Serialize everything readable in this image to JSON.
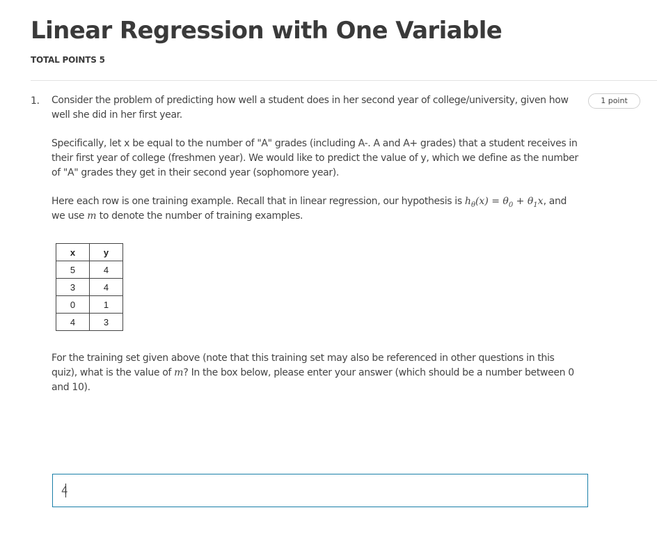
{
  "header": {
    "title": "Linear Regression with One Variable",
    "total_points": "TOTAL POINTS 5"
  },
  "question": {
    "number": "1.",
    "points": "1 point",
    "intro": "Consider the problem of predicting how well a student does in her second year of college/university, given how well she did in her first year.",
    "specifics": "Specifically, let x be equal to the number of \"A\" grades (including A-. A and A+ grades) that a student receives in their first year of college (freshmen year). We would like to predict the value of y, which we define as the number of \"A\" grades they get in their second year (sophomore year).",
    "hypothesis_before": "Here each row is one training example. Recall that in linear regression, our hypothesis is ",
    "hypothesis_after": ", and we use ",
    "m_text": " to denote the number of training examples.",
    "table": {
      "headers": [
        "x",
        "y"
      ],
      "rows": [
        [
          "5",
          "4"
        ],
        [
          "3",
          "4"
        ],
        [
          "0",
          "1"
        ],
        [
          "4",
          "3"
        ]
      ]
    },
    "prompt_before": "For the training set given above (note that this training set may also be referenced in other questions in this quiz), what is the value of ",
    "prompt_after": "? In the box below, please enter your answer (which should be a number between 0 and 10).",
    "answer_value": "4"
  }
}
